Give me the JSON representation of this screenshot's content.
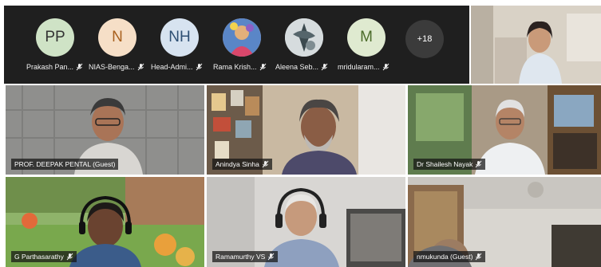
{
  "participants_strip": {
    "participants": [
      {
        "initials": "PP",
        "name": "Prakash Pan...",
        "avatar_color": "#cfe3c6",
        "muted": true
      },
      {
        "initials": "N",
        "name": "NIAS-Benga...",
        "avatar_color": "#f6dfc7",
        "muted": true
      },
      {
        "initials": "NH",
        "name": "Head-Admi...",
        "avatar_color": "#d7e3f0",
        "muted": true
      },
      {
        "initials": "",
        "name": "Rama Krish...",
        "avatar_color": "#e9a77b",
        "muted": true
      },
      {
        "initials": "",
        "name": "Aleena Seb...",
        "avatar_color": "#b9c4c9",
        "muted": true
      },
      {
        "initials": "M",
        "name": "mridularam...",
        "avatar_color": "#dfead0",
        "muted": true
      }
    ],
    "more_count": "+18"
  },
  "tiles": [
    {
      "name": "PROF. DEEPAK PENTAL (Guest)",
      "muted": false,
      "active": true
    },
    {
      "name": "Anindya Sinha",
      "muted": true,
      "active": false
    },
    {
      "name": "Dr Shailesh Nayak",
      "muted": true,
      "active": false
    },
    {
      "name": "G Parthasarathy",
      "muted": true,
      "active": false
    },
    {
      "name": "Ramamurthy VS",
      "muted": true,
      "active": false
    },
    {
      "name": "nmukunda (Guest)",
      "muted": true,
      "active": false
    }
  ],
  "colors": {
    "active_border": "#8b8cf0",
    "strip_bg": "#1f1f1f"
  }
}
